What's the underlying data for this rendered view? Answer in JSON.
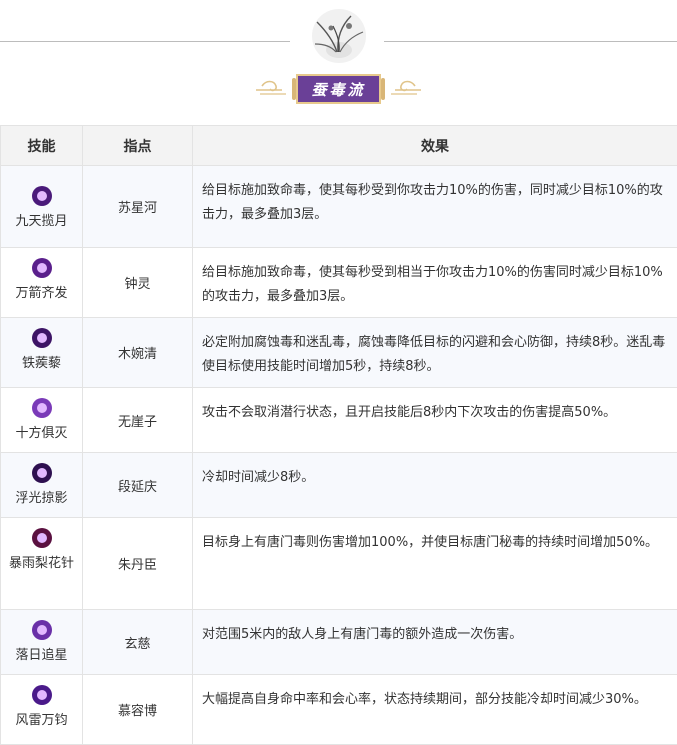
{
  "banner": {
    "title": "蚕毒流"
  },
  "table": {
    "headers": {
      "skill": "技能",
      "mentor": "指点",
      "effect": "效果"
    },
    "rows": [
      {
        "skill": "九天揽月",
        "mentor": "苏星河",
        "effect": "给目标施加致命毒，使其每秒受到你攻击力10%的伤害，同时减少目标10%的攻击力，最多叠加3层。",
        "icon": "purple-orb-icon",
        "icon_color": "#4a1a7a"
      },
      {
        "skill": "万箭齐发",
        "mentor": "钟灵",
        "effect": "给目标施加致命毒，使其每秒受到相当于你攻击力10%的伤害同时减少目标10%的攻击力，最多叠加3层。",
        "icon": "arrow-storm-icon",
        "icon_color": "#5a1f8c"
      },
      {
        "skill": "铁蒺藜",
        "mentor": "木婉清",
        "effect": "必定附加腐蚀毒和迷乱毒，腐蚀毒降低目标的闪避和会心防御，持续8秒。迷乱毒使目标使用技能时间增加5秒，持续8秒。",
        "icon": "caltrop-icon",
        "icon_color": "#3d1466"
      },
      {
        "skill": "十方俱灭",
        "mentor": "无崖子",
        "effect": "攻击不会取消潜行状态，且开启技能后8秒内下次攻击的伤害提高50%。",
        "icon": "burst-icon",
        "icon_color": "#7a3ab8"
      },
      {
        "skill": "浮光掠影",
        "mentor": "段延庆",
        "effect": "冷却时间减少8秒。",
        "icon": "shadow-icon",
        "icon_color": "#2e1050"
      },
      {
        "skill": "暴雨梨花针",
        "mentor": "朱丹臣",
        "effect": "目标身上有唐门毒则伤害增加100%，并使目标唐门秘毒的持续时间增加50%。",
        "icon": "needle-rain-icon",
        "icon_color": "#5a1040"
      },
      {
        "skill": "落日追星",
        "mentor": "玄慈",
        "effect": "对范围5米内的敌人身上有唐门毒的额外造成一次伤害。",
        "icon": "star-chase-icon",
        "icon_color": "#6a30a8"
      },
      {
        "skill": "风雷万钧",
        "mentor": "慕容博",
        "effect": "大幅提高自身命中率和会心率，状态持续期间，部分技能冷却时间减少30%。",
        "icon": "thunder-icon",
        "icon_color": "#4a1a8a"
      }
    ]
  }
}
